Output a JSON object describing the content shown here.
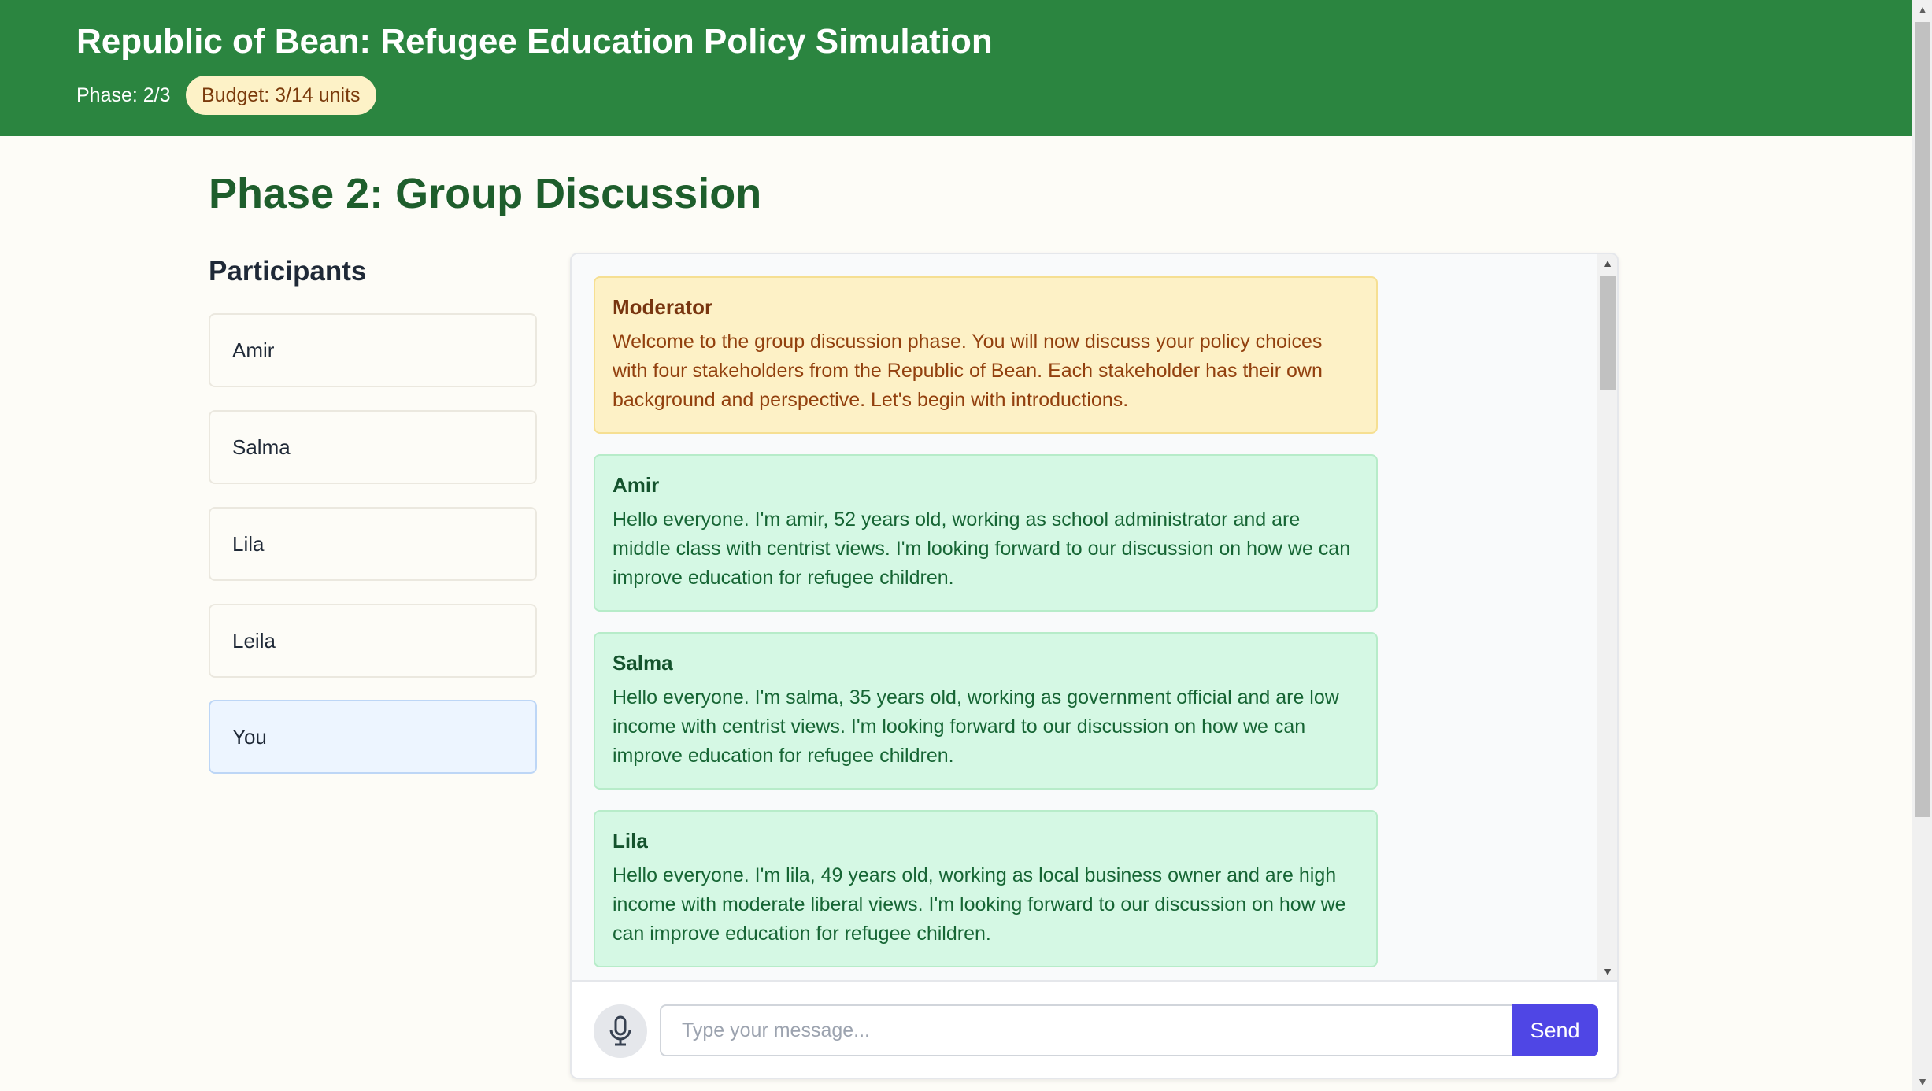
{
  "header": {
    "title": "Republic of Bean: Refugee Education Policy Simulation",
    "phase_label": "Phase: 2/3",
    "budget_label": "Budget: 3/14 units"
  },
  "main": {
    "page_title": "Phase 2: Group Discussion",
    "participants_heading": "Participants",
    "participants": [
      {
        "label": "Amir"
      },
      {
        "label": "Salma"
      },
      {
        "label": "Lila"
      },
      {
        "label": "Leila"
      },
      {
        "label": "You"
      }
    ]
  },
  "chat": {
    "messages": [
      {
        "speaker": "Moderator",
        "role": "moderator",
        "text": "Welcome to the group discussion phase. You will now discuss your policy choices with four stakeholders from the Republic of Bean. Each stakeholder has their own background and perspective. Let's begin with introductions."
      },
      {
        "speaker": "Amir",
        "role": "stakeholder",
        "text": "Hello everyone. I'm amir, 52 years old, working as school administrator and are middle class with centrist views. I'm looking forward to our discussion on how we can improve education for refugee children."
      },
      {
        "speaker": "Salma",
        "role": "stakeholder",
        "text": "Hello everyone. I'm salma, 35 years old, working as government official and are low income with centrist views. I'm looking forward to our discussion on how we can improve education for refugee children."
      },
      {
        "speaker": "Lila",
        "role": "stakeholder",
        "text": "Hello everyone. I'm lila, 49 years old, working as local business owner and are high income with moderate liberal views. I'm looking forward to our discussion on how we can improve education for refugee children."
      }
    ],
    "input_placeholder": "Type your message...",
    "send_label": "Send"
  },
  "colors": {
    "header_bg": "#2b8540",
    "page_title": "#1e5e2c",
    "moderator_bg": "#fdf1c6",
    "stakeholder_bg": "#d5f8e4",
    "send_bg": "#4f46e5"
  },
  "icons": {
    "mic": "microphone-icon"
  }
}
